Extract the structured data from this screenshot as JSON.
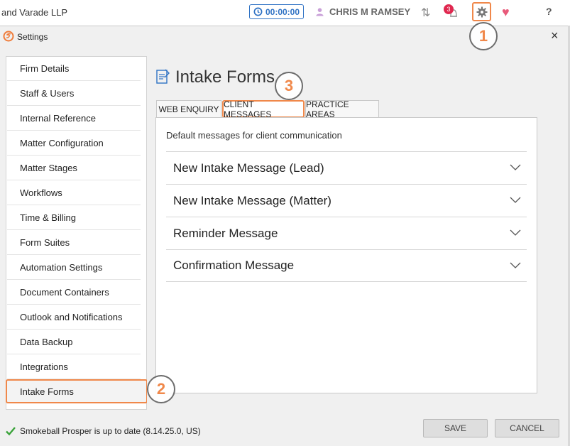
{
  "topbar": {
    "firm_name": "and Varade LLP",
    "timer": "00:00:00",
    "user_name": "CHRIS M RAMSEY",
    "notification_count": "3",
    "help_label": "?",
    "icons": [
      "clock-icon",
      "user-icon",
      "sync-icon",
      "bell-icon",
      "gear-icon",
      "heart-icon",
      "help-icon"
    ]
  },
  "dialog": {
    "title": "Settings",
    "close_label": "×"
  },
  "sidebar": {
    "items": [
      {
        "label": "Firm Details"
      },
      {
        "label": "Staff & Users"
      },
      {
        "label": "Internal Reference"
      },
      {
        "label": "Matter Configuration"
      },
      {
        "label": "Matter Stages"
      },
      {
        "label": "Workflows"
      },
      {
        "label": "Time & Billing"
      },
      {
        "label": "Form Suites"
      },
      {
        "label": "Automation Settings"
      },
      {
        "label": "Document Containers"
      },
      {
        "label": "Outlook and Notifications"
      },
      {
        "label": "Data Backup"
      },
      {
        "label": "Integrations"
      },
      {
        "label": "Intake Forms"
      }
    ],
    "selected": "Intake Forms"
  },
  "main": {
    "title": "Intake Forms",
    "tabs": [
      {
        "label": "WEB ENQUIRY"
      },
      {
        "label": "CLIENT MESSAGES"
      },
      {
        "label": "PRACTICE AREAS"
      }
    ],
    "active_tab": "CLIENT MESSAGES",
    "description": "Default messages for client communication",
    "accordions": [
      {
        "label": "New Intake Message (Lead)"
      },
      {
        "label": "New Intake Message (Matter)"
      },
      {
        "label": "Reminder Message"
      },
      {
        "label": "Confirmation Message"
      }
    ]
  },
  "callouts": [
    "1",
    "2",
    "3"
  ],
  "footer": {
    "status": "Smokeball Prosper is up to date (8.14.25.0, US)",
    "save_label": "SAVE",
    "cancel_label": "CANCEL"
  },
  "colors": {
    "accent_orange": "#f0884a",
    "timer_blue": "#2f72c4",
    "badge_red": "#e0284f",
    "check_green": "#3aa33a"
  }
}
